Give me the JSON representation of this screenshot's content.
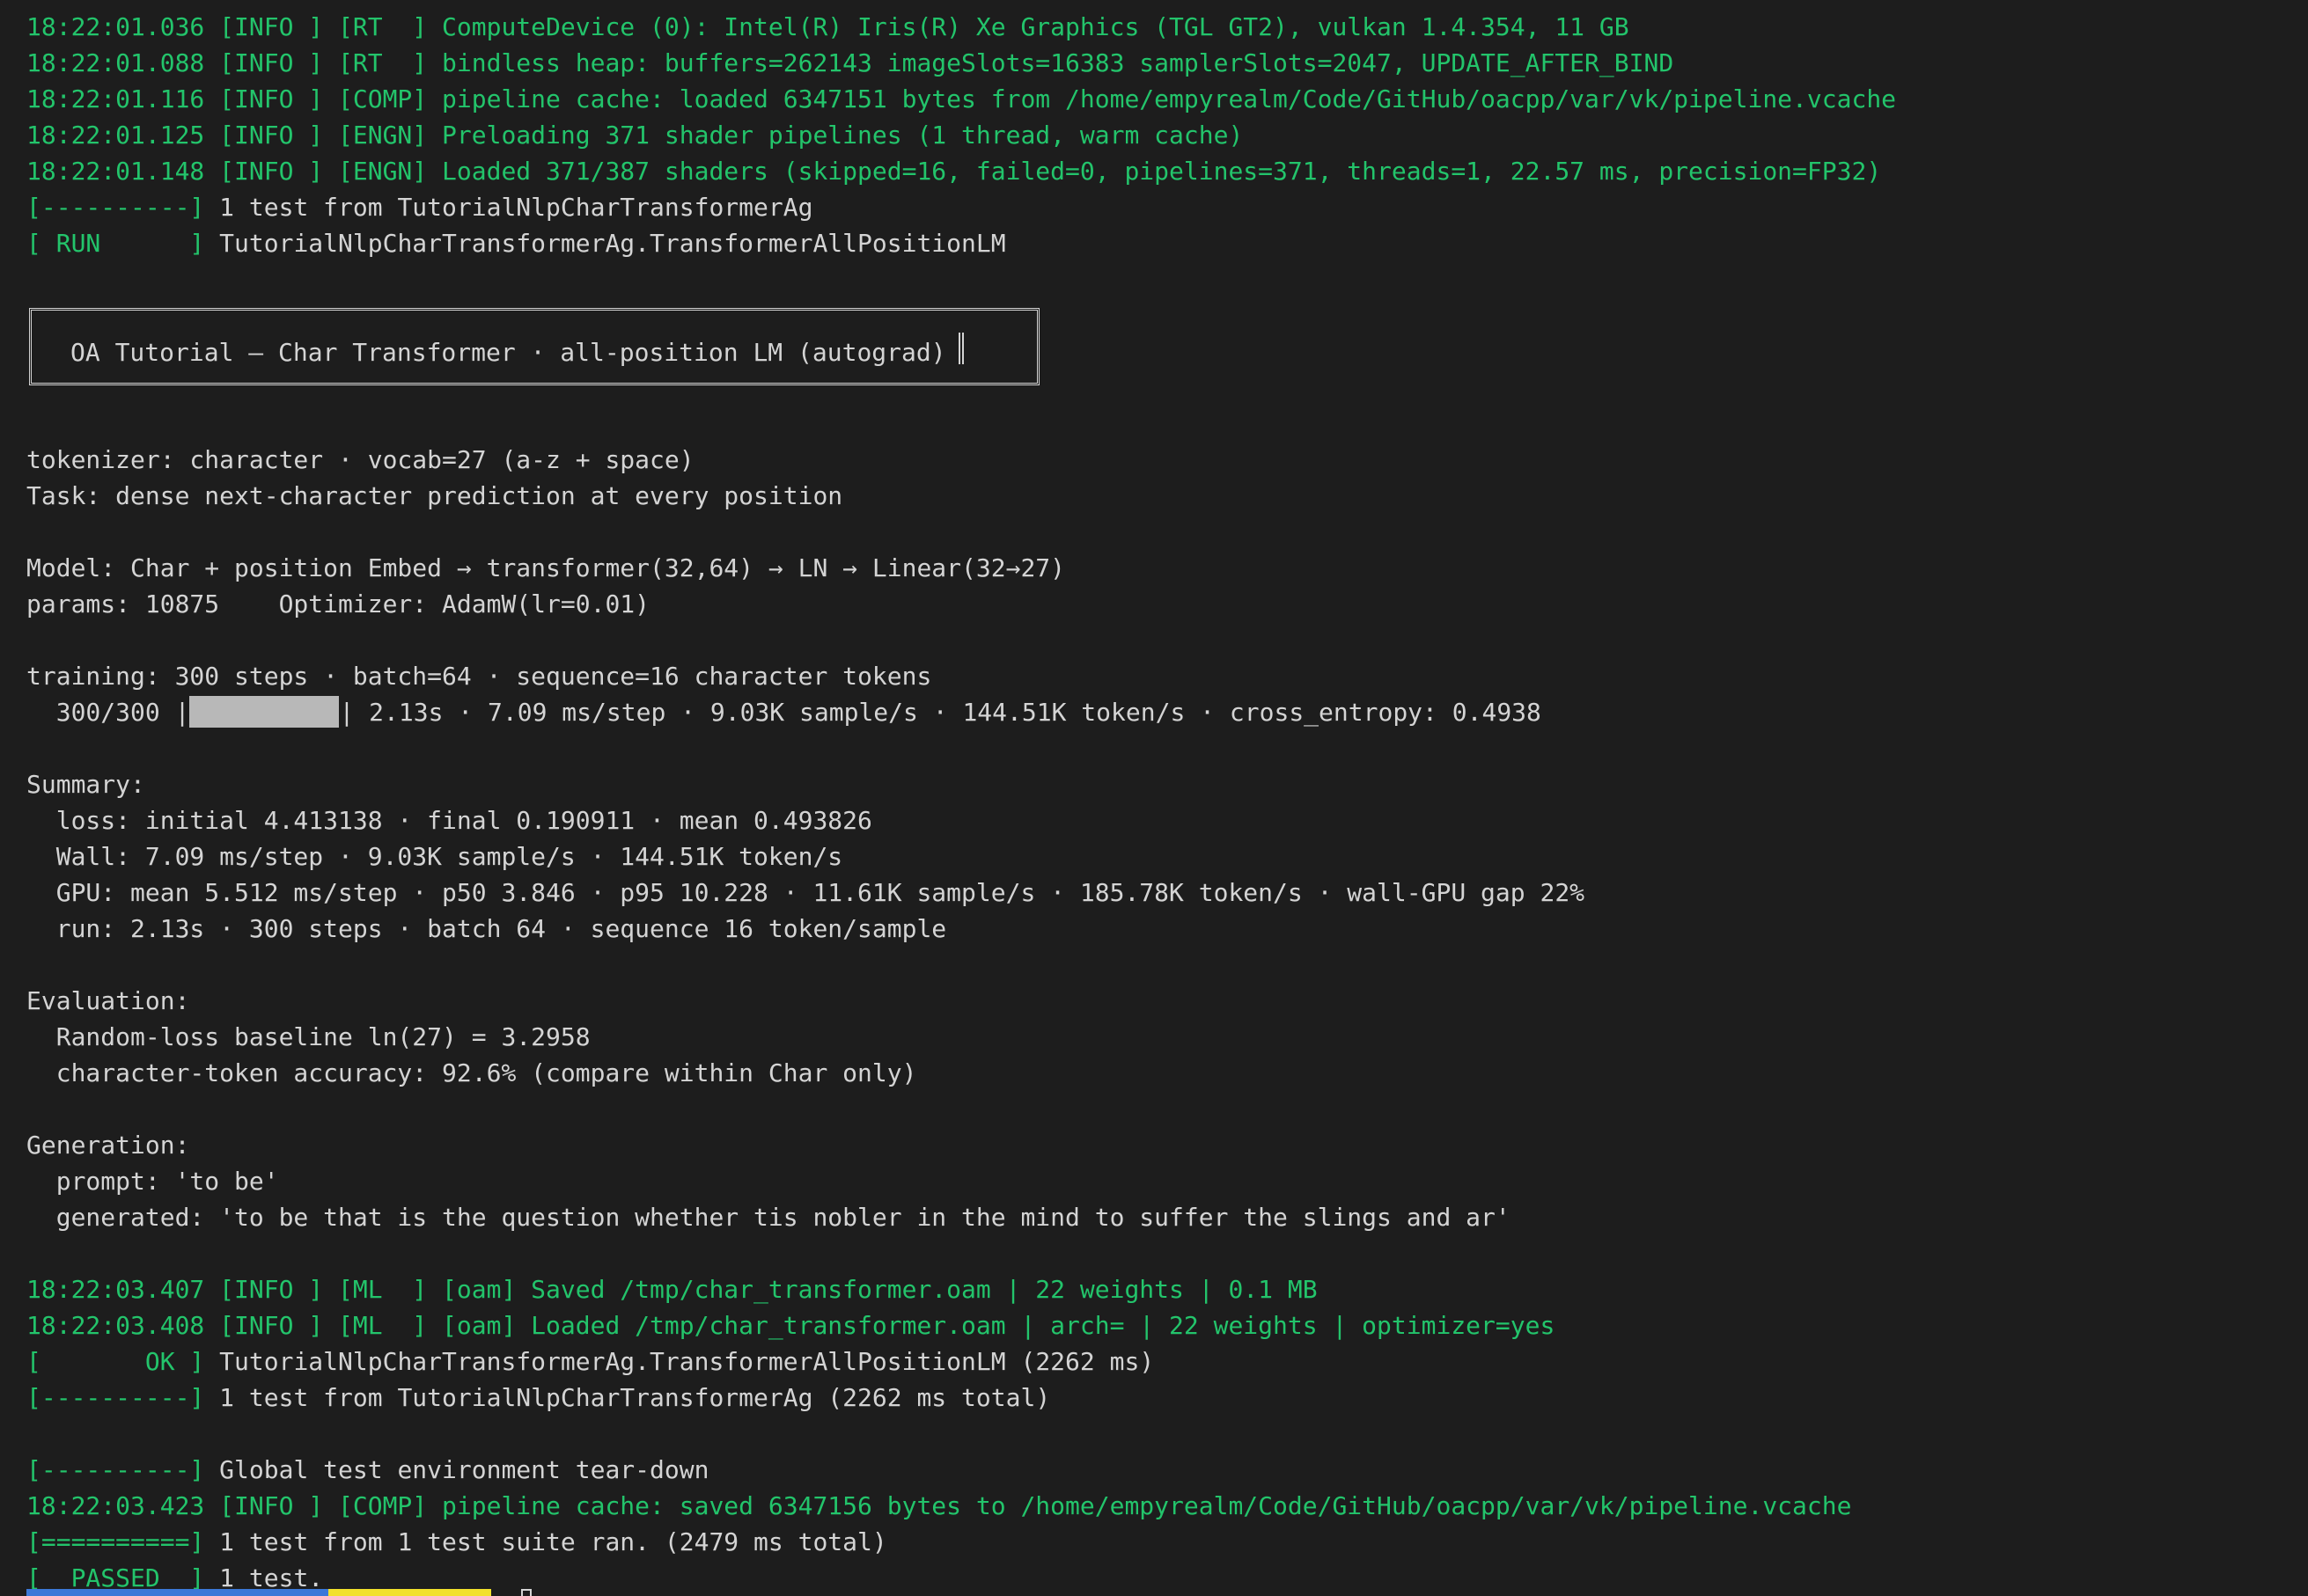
{
  "colors": {
    "background": "#1d1d1d",
    "foreground": "#d4d4d4",
    "log_green": "#23c46b",
    "status_blue": "#3b78d8",
    "status_yellow": "#f2e12b"
  },
  "lines": {
    "l0": "18:22:01.036 [INFO ] [RT  ] ComputeDevice (0): Intel(R) Iris(R) Xe Graphics (TGL GT2), vulkan 1.4.354, 11 GB",
    "l1": "18:22:01.088 [INFO ] [RT  ] bindless heap: buffers=262143 imageSlots=16383 samplerSlots=2047, UPDATE_AFTER_BIND",
    "l2": "18:22:01.116 [INFO ] [COMP] pipeline cache: loaded 6347151 bytes from /home/empyrealm/Code/GitHub/oacpp/var/vk/pipeline.vcache",
    "l3": "18:22:01.125 [INFO ] [ENGN] Preloading 371 shader pipelines (1 thread, warm cache)",
    "l4": "18:22:01.148 [INFO ] [ENGN] Loaded 371/387 shaders (skipped=16, failed=0, pipelines=371, threads=1, 22.57 ms, precision=FP32)",
    "l5_tag": "[----------]",
    "l5_text": " 1 test from TutorialNlpCharTransformerAg",
    "l6_tag": "[ RUN      ]",
    "l6_text": " TutorialNlpCharTransformerAg.TransformerAllPositionLM",
    "banner": "OA Tutorial — Char Transformer · all-position LM (autograd)",
    "tokenizer": "tokenizer: character · vocab=27 (a-z + space)",
    "task": "Task: dense next-character prediction at every position",
    "model": "Model: Char + position Embed → transformer(32,64) → LN → Linear(32→27)",
    "params": "params: 10875    Optimizer: AdamW(lr=0.01)",
    "training": "training: 300 steps · batch=64 · sequence=16 character tokens",
    "progress_prefix": "  300/300 |",
    "progress_suffix": "| 2.13s · 7.09 ms/step · 9.03K sample/s · 144.51K token/s · cross_entropy: 0.4938",
    "summary": "Summary:",
    "loss": "  loss: initial 4.413138 · final 0.190911 · mean 0.493826",
    "wall": "  Wall: 7.09 ms/step · 9.03K sample/s · 144.51K token/s",
    "gpu": "  GPU: mean 5.512 ms/step · p50 3.846 · p95 10.228 · 11.61K sample/s · 185.78K token/s · wall-GPU gap 22%",
    "run": "  run: 2.13s · 300 steps · batch 64 · sequence 16 token/sample",
    "evaluation": "Evaluation:",
    "baseline": "  Random-loss baseline ln(27) = 3.2958",
    "accuracy": "  character-token accuracy: 92.6% (compare within Char only)",
    "generation": "Generation:",
    "prompt": "  prompt: 'to be'",
    "generated": "  generated: 'to be that is the question whether tis nobler in the mind to suffer the slings and ar'",
    "saved": "18:22:03.407 [INFO ] [ML  ] [oam] Saved /tmp/char_transformer.oam | 22 weights | 0.1 MB",
    "loaded": "18:22:03.408 [INFO ] [ML  ] [oam] Loaded /tmp/char_transformer.oam | arch= | 22 weights | optimizer=yes",
    "ok_tag": "[       OK ]",
    "ok_text": " TutorialNlpCharTransformerAg.TransformerAllPositionLM (2262 ms)",
    "total_tag": "[----------]",
    "total_text": " 1 test from TutorialNlpCharTransformerAg (2262 ms total)",
    "teardown_tag": "[----------]",
    "teardown_text": " Global test environment tear-down",
    "cache_saved": "18:22:03.423 [INFO ] [COMP] pipeline cache: saved 6347156 bytes to /home/empyrealm/Code/GitHub/oacpp/var/vk/pipeline.vcache",
    "ran_tag": "[==========]",
    "ran_text": " 1 test from 1 test suite ran. (2479 ms total)",
    "passed_tag": "[  PASSED  ]",
    "passed_text": " 1 test."
  },
  "progress": {
    "current": 300,
    "total": 300,
    "fraction": 1.0
  }
}
